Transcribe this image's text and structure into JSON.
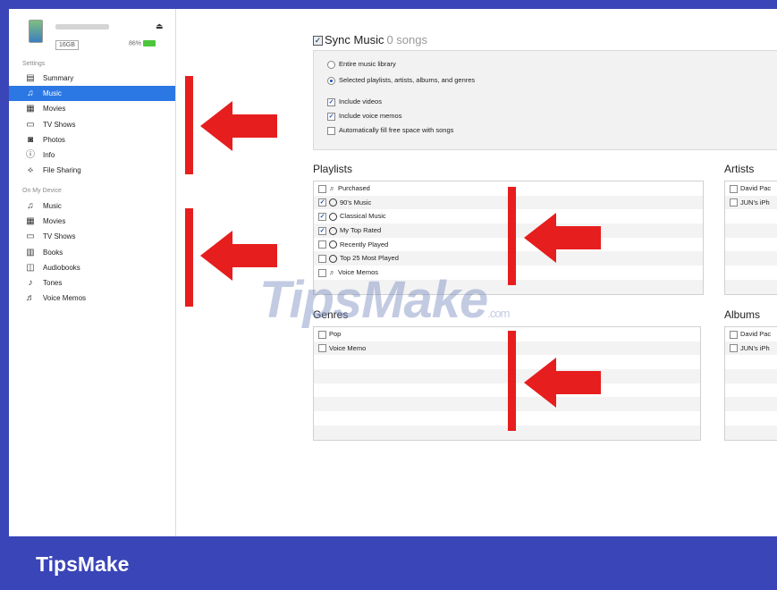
{
  "device": {
    "capacity": "16GB",
    "battery": "86%",
    "eject_symbol": "⏏"
  },
  "sidebar": {
    "settings_header": "Settings",
    "settings_items": [
      {
        "label": "Summary",
        "icon": "summary-icon",
        "glyph": "▤"
      },
      {
        "label": "Music",
        "icon": "music-note-icon",
        "glyph": "♫",
        "active": true
      },
      {
        "label": "Movies",
        "icon": "film-icon",
        "glyph": "▦"
      },
      {
        "label": "TV Shows",
        "icon": "tv-icon",
        "glyph": "▭"
      },
      {
        "label": "Photos",
        "icon": "camera-icon",
        "glyph": "◙"
      },
      {
        "label": "Info",
        "icon": "info-icon",
        "glyph": "ⓘ"
      },
      {
        "label": "File Sharing",
        "icon": "file-sharing-icon",
        "glyph": "⟡"
      }
    ],
    "device_header": "On My Device",
    "device_items": [
      {
        "label": "Music",
        "icon": "music-note-icon",
        "glyph": "♫"
      },
      {
        "label": "Movies",
        "icon": "film-icon",
        "glyph": "▦"
      },
      {
        "label": "TV Shows",
        "icon": "tv-icon",
        "glyph": "▭"
      },
      {
        "label": "Books",
        "icon": "books-icon",
        "glyph": "▥"
      },
      {
        "label": "Audiobooks",
        "icon": "audiobook-icon",
        "glyph": "◫"
      },
      {
        "label": "Tones",
        "icon": "bell-icon",
        "glyph": "♪"
      },
      {
        "label": "Voice Memos",
        "icon": "voice-memo-icon",
        "glyph": "♬"
      }
    ]
  },
  "sync": {
    "title": "Sync Music",
    "count": "0 songs",
    "options": [
      {
        "label": "Entire music library",
        "kind": "radio",
        "checked": false
      },
      {
        "label": "Selected playlists, artists, albums, and genres",
        "kind": "radio",
        "checked": true
      },
      {
        "label": "Include videos",
        "kind": "checkbox",
        "checked": true
      },
      {
        "label": "Include voice memos",
        "kind": "checkbox",
        "checked": true
      },
      {
        "label": "Automatically fill free space with songs",
        "kind": "checkbox",
        "checked": false
      }
    ]
  },
  "playlists": {
    "title": "Playlists",
    "items": [
      {
        "label": "Purchased",
        "checked": false,
        "icon": "playlist-icon"
      },
      {
        "label": "90's Music",
        "checked": true,
        "icon": "smart-playlist-icon"
      },
      {
        "label": "Classical Music",
        "checked": true,
        "icon": "smart-playlist-icon"
      },
      {
        "label": "My Top Rated",
        "checked": true,
        "icon": "smart-playlist-icon"
      },
      {
        "label": "Recently Played",
        "checked": false,
        "icon": "smart-playlist-icon"
      },
      {
        "label": "Top 25 Most Played",
        "checked": false,
        "icon": "smart-playlist-icon"
      },
      {
        "label": "Voice Memos",
        "checked": false,
        "icon": "playlist-icon"
      }
    ]
  },
  "artists": {
    "title": "Artists",
    "items": [
      {
        "label": "David Pac",
        "checked": false
      },
      {
        "label": "JUN's iPh",
        "checked": false
      }
    ]
  },
  "genres": {
    "title": "Genres",
    "items": [
      {
        "label": "Pop",
        "checked": false
      },
      {
        "label": "Voice Memo",
        "checked": false
      }
    ]
  },
  "albums": {
    "title": "Albums",
    "items": [
      {
        "label": "David Pac",
        "checked": false
      },
      {
        "label": "JUN's iPh",
        "checked": false
      }
    ]
  },
  "branding": {
    "watermark_main": "TipsMake",
    "watermark_domain": ".com",
    "footer": "TipsMake"
  },
  "colors": {
    "frame": "#3a45b8",
    "selection": "#2b78e4",
    "annotation_red": "#e61e1e"
  }
}
